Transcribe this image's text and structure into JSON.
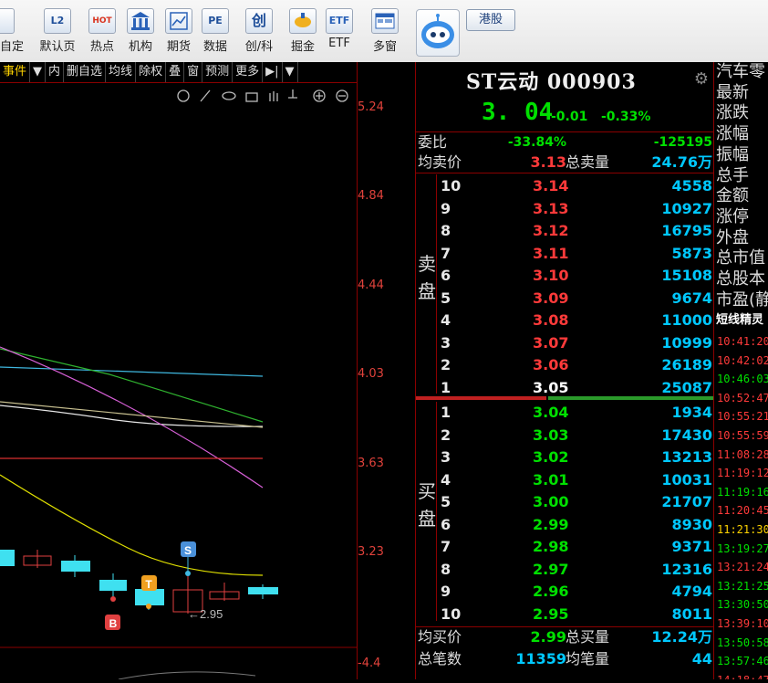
{
  "toolbar": {
    "buttons": [
      {
        "label": "自定",
        "icon": "custom-icon"
      },
      {
        "label": "默认页",
        "icon": "home-l2-icon"
      },
      {
        "label": "热点",
        "icon": "hot-icon"
      },
      {
        "label": "机构",
        "icon": "institution-icon"
      },
      {
        "label": "期货",
        "icon": "futures-icon"
      },
      {
        "label": "数据",
        "icon": "pe-data-icon"
      },
      {
        "label": "创/科",
        "icon": "chuang-icon"
      },
      {
        "label": "掘金",
        "icon": "dig-gold-icon"
      },
      {
        "label": "ETF",
        "icon": "etf-icon"
      },
      {
        "label": "多窗",
        "icon": "multi-window-icon"
      }
    ],
    "hk_label": "港股",
    "icon_text": {
      "l2": "L2",
      "hot": "HOT",
      "pe": "PE",
      "chuang": "创",
      "etf": "ETF"
    }
  },
  "chart_tabs": [
    "事件",
    "▼",
    "内",
    "删自选",
    "均线",
    "除权",
    "叠",
    "窗",
    "预测",
    "更多",
    "▶|",
    "▼"
  ],
  "chart": {
    "y_ticks": [
      "5.24",
      "4.84",
      "4.44",
      "4.03",
      "3.63",
      "3.23",
      "-4.4"
    ],
    "low_label": "←2.95",
    "markers": {
      "s": "S",
      "t": "T",
      "b": "B"
    }
  },
  "quote": {
    "title": "ST云动 000903",
    "price": "3. 04",
    "change": "-0.01",
    "change_pct": "-0.33%",
    "weibi_label": "委比",
    "weibi_pct": "-33.84%",
    "weibi_diff": "-125195",
    "avg_sell_label": "均卖价",
    "avg_sell_price": "3.13",
    "total_sell_label": "总卖量",
    "total_sell_vol": "24.76万",
    "sell_side_label": [
      "卖",
      "盘"
    ],
    "buy_side_label": [
      "买",
      "盘"
    ],
    "sells": [
      {
        "level": "10",
        "price": "3.14",
        "vol": "4558"
      },
      {
        "level": "9",
        "price": "3.13",
        "vol": "10927"
      },
      {
        "level": "8",
        "price": "3.12",
        "vol": "16795"
      },
      {
        "level": "7",
        "price": "3.11",
        "vol": "5873"
      },
      {
        "level": "6",
        "price": "3.10",
        "vol": "15108"
      },
      {
        "level": "5",
        "price": "3.09",
        "vol": "9674"
      },
      {
        "level": "4",
        "price": "3.08",
        "vol": "11000"
      },
      {
        "level": "3",
        "price": "3.07",
        "vol": "10999"
      },
      {
        "level": "2",
        "price": "3.06",
        "vol": "26189"
      },
      {
        "level": "1",
        "price": "3.05",
        "vol": "25087"
      }
    ],
    "buys": [
      {
        "level": "1",
        "price": "3.04",
        "vol": "1934"
      },
      {
        "level": "2",
        "price": "3.03",
        "vol": "17430"
      },
      {
        "level": "3",
        "price": "3.02",
        "vol": "13213"
      },
      {
        "level": "4",
        "price": "3.01",
        "vol": "10031"
      },
      {
        "level": "5",
        "price": "3.00",
        "vol": "21707"
      },
      {
        "level": "6",
        "price": "2.99",
        "vol": "8930"
      },
      {
        "level": "7",
        "price": "2.98",
        "vol": "9371"
      },
      {
        "level": "8",
        "price": "2.97",
        "vol": "12316"
      },
      {
        "level": "9",
        "price": "2.96",
        "vol": "4794"
      },
      {
        "level": "10",
        "price": "2.95",
        "vol": "8011"
      }
    ],
    "avg_buy_label": "均买价",
    "avg_buy_price": "2.99",
    "total_buy_label": "总买量",
    "total_buy_vol": "12.24万",
    "total_trades_label": "总笔数",
    "total_trades": "11359",
    "avg_trade_label": "均笔量",
    "avg_trade_vol": "44"
  },
  "far_right": {
    "labels": [
      "汽车零",
      "最新",
      "涨跌",
      "涨幅",
      "振幅",
      "总手",
      "金额",
      "涨停",
      "外盘",
      "总市值",
      "总股本",
      "市盈(静"
    ],
    "section": "短线精灵",
    "times": [
      {
        "t": "10:41:20",
        "c": "#ff3a3a"
      },
      {
        "t": "10:42:02",
        "c": "#ff3a3a"
      },
      {
        "t": "10:46:03",
        "c": "#00e000"
      },
      {
        "t": "10:52:47",
        "c": "#ff3a3a"
      },
      {
        "t": "10:55:21",
        "c": "#ff3a3a"
      },
      {
        "t": "10:55:59",
        "c": "#ff3a3a"
      },
      {
        "t": "11:08:28",
        "c": "#ff3a3a"
      },
      {
        "t": "11:19:12",
        "c": "#ff3a3a"
      },
      {
        "t": "11:19:16",
        "c": "#00e000"
      },
      {
        "t": "11:20:45",
        "c": "#ff3a3a"
      },
      {
        "t": "11:21:30",
        "c": "#ffd400"
      },
      {
        "t": "13:19:27",
        "c": "#00e000"
      },
      {
        "t": "13:21:24",
        "c": "#ff3a3a"
      },
      {
        "t": "13:21:25",
        "c": "#00e000"
      },
      {
        "t": "13:30:50",
        "c": "#00e000"
      },
      {
        "t": "13:39:10",
        "c": "#ff3a3a"
      },
      {
        "t": "13:50:58",
        "c": "#00e000"
      },
      {
        "t": "13:57:46",
        "c": "#00e000"
      },
      {
        "t": "14:18:47",
        "c": "#ff3a3a"
      }
    ]
  },
  "colors": {
    "up": "#ff3a3a",
    "down": "#00e000",
    "vol": "#00c8ff",
    "axis": "#e0423b"
  }
}
